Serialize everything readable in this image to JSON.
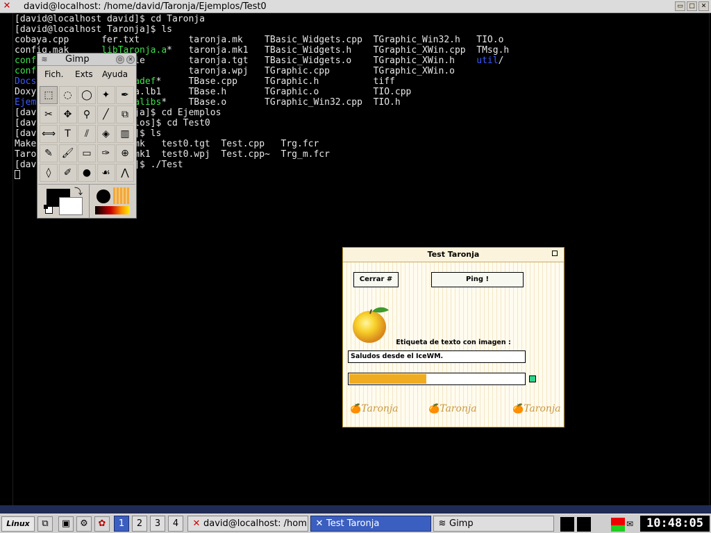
{
  "terminal": {
    "title": "david@localhost: /home/david/Taronja/Ejemplos/Test0",
    "controls": [
      "minimize",
      "maximize",
      "close"
    ],
    "lines": [
      [
        {
          "t": "[david@localhost david]$ cd Taronja",
          "c": "w"
        }
      ],
      [
        {
          "t": "[david@localhost Taronja]$ ls",
          "c": "w"
        }
      ],
      [
        {
          "t": "cobaya.cpp      ",
          "c": "w"
        },
        {
          "t": "fer.txt         taronja.mk    TBasic_Widgets.cpp  TGraphic_Win32.h   TIO.o",
          "c": "w"
        }
      ],
      [
        {
          "t": "config.mak      ",
          "c": "w"
        },
        {
          "t": "libTaronja.a",
          "c": "g"
        },
        {
          "t": "*   taronja.mk1   TBasic_Widgets.h    TGraphic_XWin.cpp  TMsg.h",
          "c": "w"
        }
      ],
      [
        {
          "t": "configure       ",
          "c": "g"
        },
        {
          "t": "makefile        taronja.tgt   TBasic_Widgets.o    TGraphic_XWin.h    ",
          "c": "w"
        },
        {
          "t": "util",
          "c": "b"
        },
        {
          "t": "/",
          "c": "w"
        }
      ],
      [
        {
          "t": "configure.in    ",
          "c": "g"
        },
        {
          "t": "png             taronja.wpj   TGraphic.cpp        TGraphic_XWin.o",
          "c": "w"
        }
      ],
      [
        {
          "t": "Docs            ",
          "c": "b"
        },
        {
          "t": "Taronjadef",
          "c": "g"
        },
        {
          "t": "*     TBase.cpp     TGraphic.h          tiff",
          "c": "w"
        }
      ],
      [
        {
          "t": "Doxyfile        taronja.lb1     TBase.h       TGraphic.o          TIO.cpp",
          "c": "w"
        }
      ],
      [
        {
          "t": "Ejemplos        ",
          "c": "b"
        },
        {
          "t": "Taronjalibs",
          "c": "g"
        },
        {
          "t": "*    TBase.o       TGraphic_Win32.cpp  TIO.h",
          "c": "w"
        }
      ],
      [
        {
          "t": "[david@localhost Taronja]$ cd Ejemplos",
          "c": "w"
        }
      ],
      [
        {
          "t": "[david@localhost Ejemplos]$ cd Test0",
          "c": "w"
        }
      ],
      [
        {
          "t": "[david@localhost Test0]$ ls",
          "c": "w"
        }
      ],
      [
        {
          "t": "Makefile        test0.mk   test0.tgt  Test.cpp   Trg.fcr",
          "c": "w"
        }
      ],
      [
        {
          "t": "Taronja.lk1     test0.mk1  test0.wpj  Test.cpp~  Trg_m.fcr",
          "c": "w"
        }
      ],
      [
        {
          "t": "[david@localhost Test0]$ ./Test",
          "c": "w"
        }
      ]
    ]
  },
  "gimp": {
    "title": "Gimp",
    "menu": [
      "Fich.",
      "Exts",
      "Ayuda"
    ],
    "tools": [
      "rect-select-icon",
      "ellipse-select-icon",
      "free-select-icon",
      "fuzzy-select-icon",
      "bezier-select-icon",
      "scissors-icon",
      "move-icon",
      "zoom-icon",
      "crop-icon",
      "transform-icon",
      "flip-icon",
      "text-icon",
      "color-picker-icon",
      "bucket-fill-icon",
      "blend-icon",
      "pencil-icon",
      "paintbrush-icon",
      "eraser-icon",
      "airbrush-icon",
      "clone-icon",
      "convolve-icon",
      "ink-icon",
      "dodge-burn-icon",
      "smudge-icon",
      "measure-icon"
    ],
    "tool_glyphs": [
      "⬚",
      "◌",
      "◯",
      "✦",
      "✒",
      "✂",
      "✥",
      "⚲",
      "╱",
      "⧉",
      "⟺",
      "T",
      "⫽",
      "◈",
      "▥",
      "✎",
      "🖌",
      "▭",
      "✑",
      "⊕",
      "◊",
      "✐",
      "●",
      "☙",
      "⋀"
    ],
    "selected_tool": 0,
    "colors": {
      "foreground": "#000000",
      "background": "#ffffff"
    }
  },
  "taronja": {
    "title": "Test Taronja",
    "close_btn": "close",
    "button_close": "Cerrar #",
    "button_ping": "Ping !",
    "label": "Etiqueta de texto con imagen :",
    "text_value": "Saludos desde el IceWM.",
    "progress": 0.44,
    "watermark": [
      "Taronja",
      "Taronja",
      "Taronja"
    ],
    "accent": "#f0ac20"
  },
  "taskbar": {
    "start": "Linux",
    "workspaces": [
      "1",
      "2",
      "3",
      "4"
    ],
    "active_workspace": "1",
    "tasks": [
      {
        "label": "david@localhost: /hom...",
        "icon": "x-icon",
        "active": false
      },
      {
        "label": "Test Taronja",
        "icon": "x-icon",
        "active": true
      },
      {
        "label": "Gimp",
        "icon": "gimp-icon",
        "active": false
      }
    ],
    "clock": "10:48:05"
  }
}
